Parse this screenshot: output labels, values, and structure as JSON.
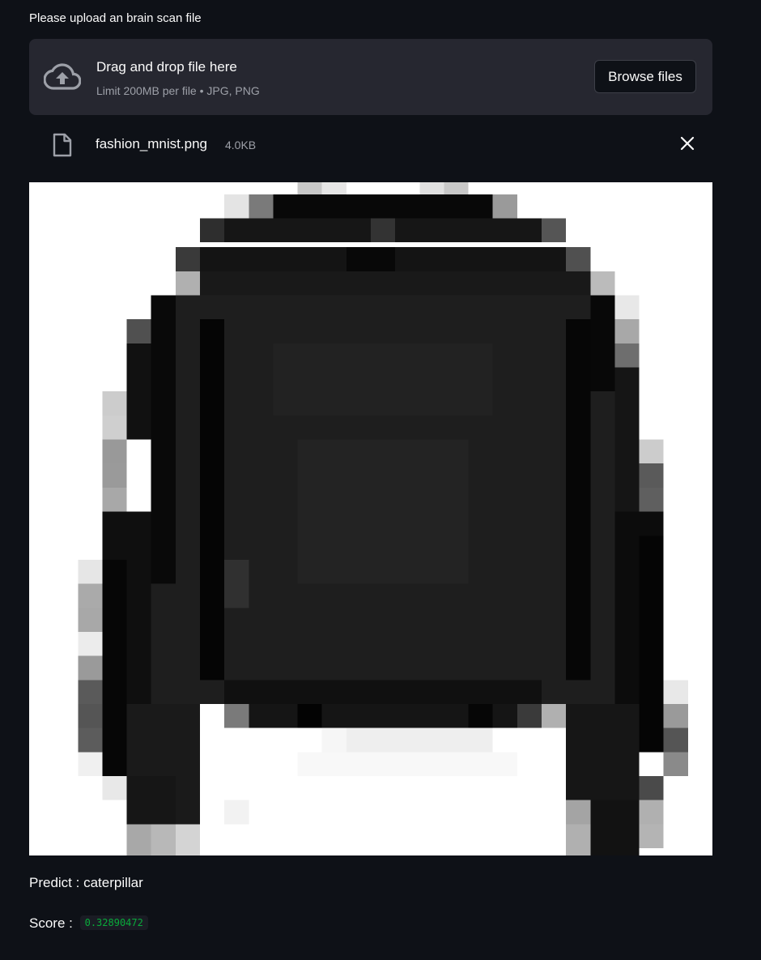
{
  "uploader": {
    "label": "Please upload an brain scan file",
    "dropzone": {
      "title": "Drag and drop file here",
      "limit": "Limit 200MB per file • JPG, PNG",
      "icon": "cloud-upload-icon",
      "browse_label": "Browse files"
    },
    "file": {
      "icon": "file-icon",
      "name": "fashion_mnist.png",
      "size": "4.0KB",
      "remove_icon": "close-icon"
    }
  },
  "preview": {
    "image": "uploaded-image-preview"
  },
  "result": {
    "predict_label": "Predict : ",
    "predict_value": "caterpillar",
    "score_label": "Score : ",
    "score_value": "0.32890472"
  },
  "colors": {
    "background": "#0e1117",
    "dropzone": "#262730",
    "text": "#fafafa",
    "muted": "#9da0a8",
    "score_code": "#09ab3b"
  }
}
